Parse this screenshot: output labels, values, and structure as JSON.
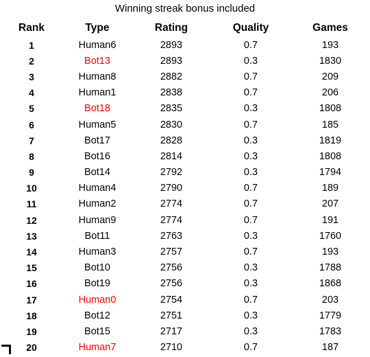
{
  "figure": {
    "title": "Winning streak bonus included",
    "highlight_color": "#ff0000",
    "text_color": "#000000",
    "background_color": "#ffffff"
  },
  "corner_marker": {
    "name": "corner-bracket",
    "shape": "top-right-corner-bracket"
  },
  "table": {
    "columns": [
      {
        "key": "rank",
        "label": "Rank"
      },
      {
        "key": "type",
        "label": "Type"
      },
      {
        "key": "rating",
        "label": "Rating"
      },
      {
        "key": "quality",
        "label": "Quality"
      },
      {
        "key": "games",
        "label": "Games"
      }
    ],
    "rows": [
      {
        "rank": "1",
        "type": "Human6",
        "rating": "2893",
        "quality": "0.7",
        "games": "193",
        "highlighted": false
      },
      {
        "rank": "2",
        "type": "Bot13",
        "rating": "2893",
        "quality": "0.3",
        "games": "1830",
        "highlighted": true
      },
      {
        "rank": "3",
        "type": "Human8",
        "rating": "2882",
        "quality": "0.7",
        "games": "209",
        "highlighted": false
      },
      {
        "rank": "4",
        "type": "Human1",
        "rating": "2838",
        "quality": "0.7",
        "games": "206",
        "highlighted": false
      },
      {
        "rank": "5",
        "type": "Bot18",
        "rating": "2835",
        "quality": "0.3",
        "games": "1808",
        "highlighted": true
      },
      {
        "rank": "6",
        "type": "Human5",
        "rating": "2830",
        "quality": "0.7",
        "games": "185",
        "highlighted": false
      },
      {
        "rank": "7",
        "type": "Bot17",
        "rating": "2828",
        "quality": "0.3",
        "games": "1819",
        "highlighted": false
      },
      {
        "rank": "8",
        "type": "Bot16",
        "rating": "2814",
        "quality": "0.3",
        "games": "1808",
        "highlighted": false
      },
      {
        "rank": "9",
        "type": "Bot14",
        "rating": "2792",
        "quality": "0.3",
        "games": "1794",
        "highlighted": false
      },
      {
        "rank": "10",
        "type": "Human4",
        "rating": "2790",
        "quality": "0.7",
        "games": "189",
        "highlighted": false
      },
      {
        "rank": "11",
        "type": "Human2",
        "rating": "2774",
        "quality": "0.7",
        "games": "207",
        "highlighted": false
      },
      {
        "rank": "12",
        "type": "Human9",
        "rating": "2774",
        "quality": "0.7",
        "games": "191",
        "highlighted": false
      },
      {
        "rank": "13",
        "type": "Bot11",
        "rating": "2763",
        "quality": "0.3",
        "games": "1760",
        "highlighted": false
      },
      {
        "rank": "14",
        "type": "Human3",
        "rating": "2757",
        "quality": "0.7",
        "games": "193",
        "highlighted": false
      },
      {
        "rank": "15",
        "type": "Bot10",
        "rating": "2756",
        "quality": "0.3",
        "games": "1788",
        "highlighted": false
      },
      {
        "rank": "16",
        "type": "Bot19",
        "rating": "2756",
        "quality": "0.3",
        "games": "1868",
        "highlighted": false
      },
      {
        "rank": "17",
        "type": "Human0",
        "rating": "2754",
        "quality": "0.7",
        "games": "203",
        "highlighted": true
      },
      {
        "rank": "18",
        "type": "Bot12",
        "rating": "2751",
        "quality": "0.3",
        "games": "1779",
        "highlighted": false
      },
      {
        "rank": "19",
        "type": "Bot15",
        "rating": "2717",
        "quality": "0.3",
        "games": "1783",
        "highlighted": false
      },
      {
        "rank": "20",
        "type": "Human7",
        "rating": "2710",
        "quality": "0.7",
        "games": "187",
        "highlighted": true
      }
    ]
  },
  "chart_data": {
    "type": "table",
    "title": "Winning streak bonus included",
    "columns": [
      "Rank",
      "Type",
      "Rating",
      "Quality",
      "Games"
    ],
    "rows": [
      [
        "1",
        "Human6",
        2893,
        0.7,
        193
      ],
      [
        "2",
        "Bot13",
        2893,
        0.3,
        1830
      ],
      [
        "3",
        "Human8",
        2882,
        0.7,
        209
      ],
      [
        "4",
        "Human1",
        2838,
        0.7,
        206
      ],
      [
        "5",
        "Bot18",
        2835,
        0.3,
        1808
      ],
      [
        "6",
        "Human5",
        2830,
        0.7,
        185
      ],
      [
        "7",
        "Bot17",
        2828,
        0.3,
        1819
      ],
      [
        "8",
        "Bot16",
        2814,
        0.3,
        1808
      ],
      [
        "9",
        "Bot14",
        2792,
        0.3,
        1794
      ],
      [
        "10",
        "Human4",
        2790,
        0.7,
        189
      ],
      [
        "11",
        "Human2",
        2774,
        0.7,
        207
      ],
      [
        "12",
        "Human9",
        2774,
        0.7,
        191
      ],
      [
        "13",
        "Bot11",
        2763,
        0.3,
        1760
      ],
      [
        "14",
        "Human3",
        2757,
        0.7,
        193
      ],
      [
        "15",
        "Bot10",
        2756,
        0.3,
        1788
      ],
      [
        "16",
        "Bot19",
        2756,
        0.3,
        1868
      ],
      [
        "17",
        "Human0",
        2754,
        0.7,
        203
      ],
      [
        "18",
        "Bot12",
        2751,
        0.3,
        1779
      ],
      [
        "19",
        "Bot15",
        2717,
        0.3,
        1783
      ],
      [
        "20",
        "Human7",
        2710,
        0.7,
        187
      ]
    ],
    "highlighted_rows": [
      2,
      5,
      17,
      20
    ],
    "highlight_color": "#ff0000"
  }
}
